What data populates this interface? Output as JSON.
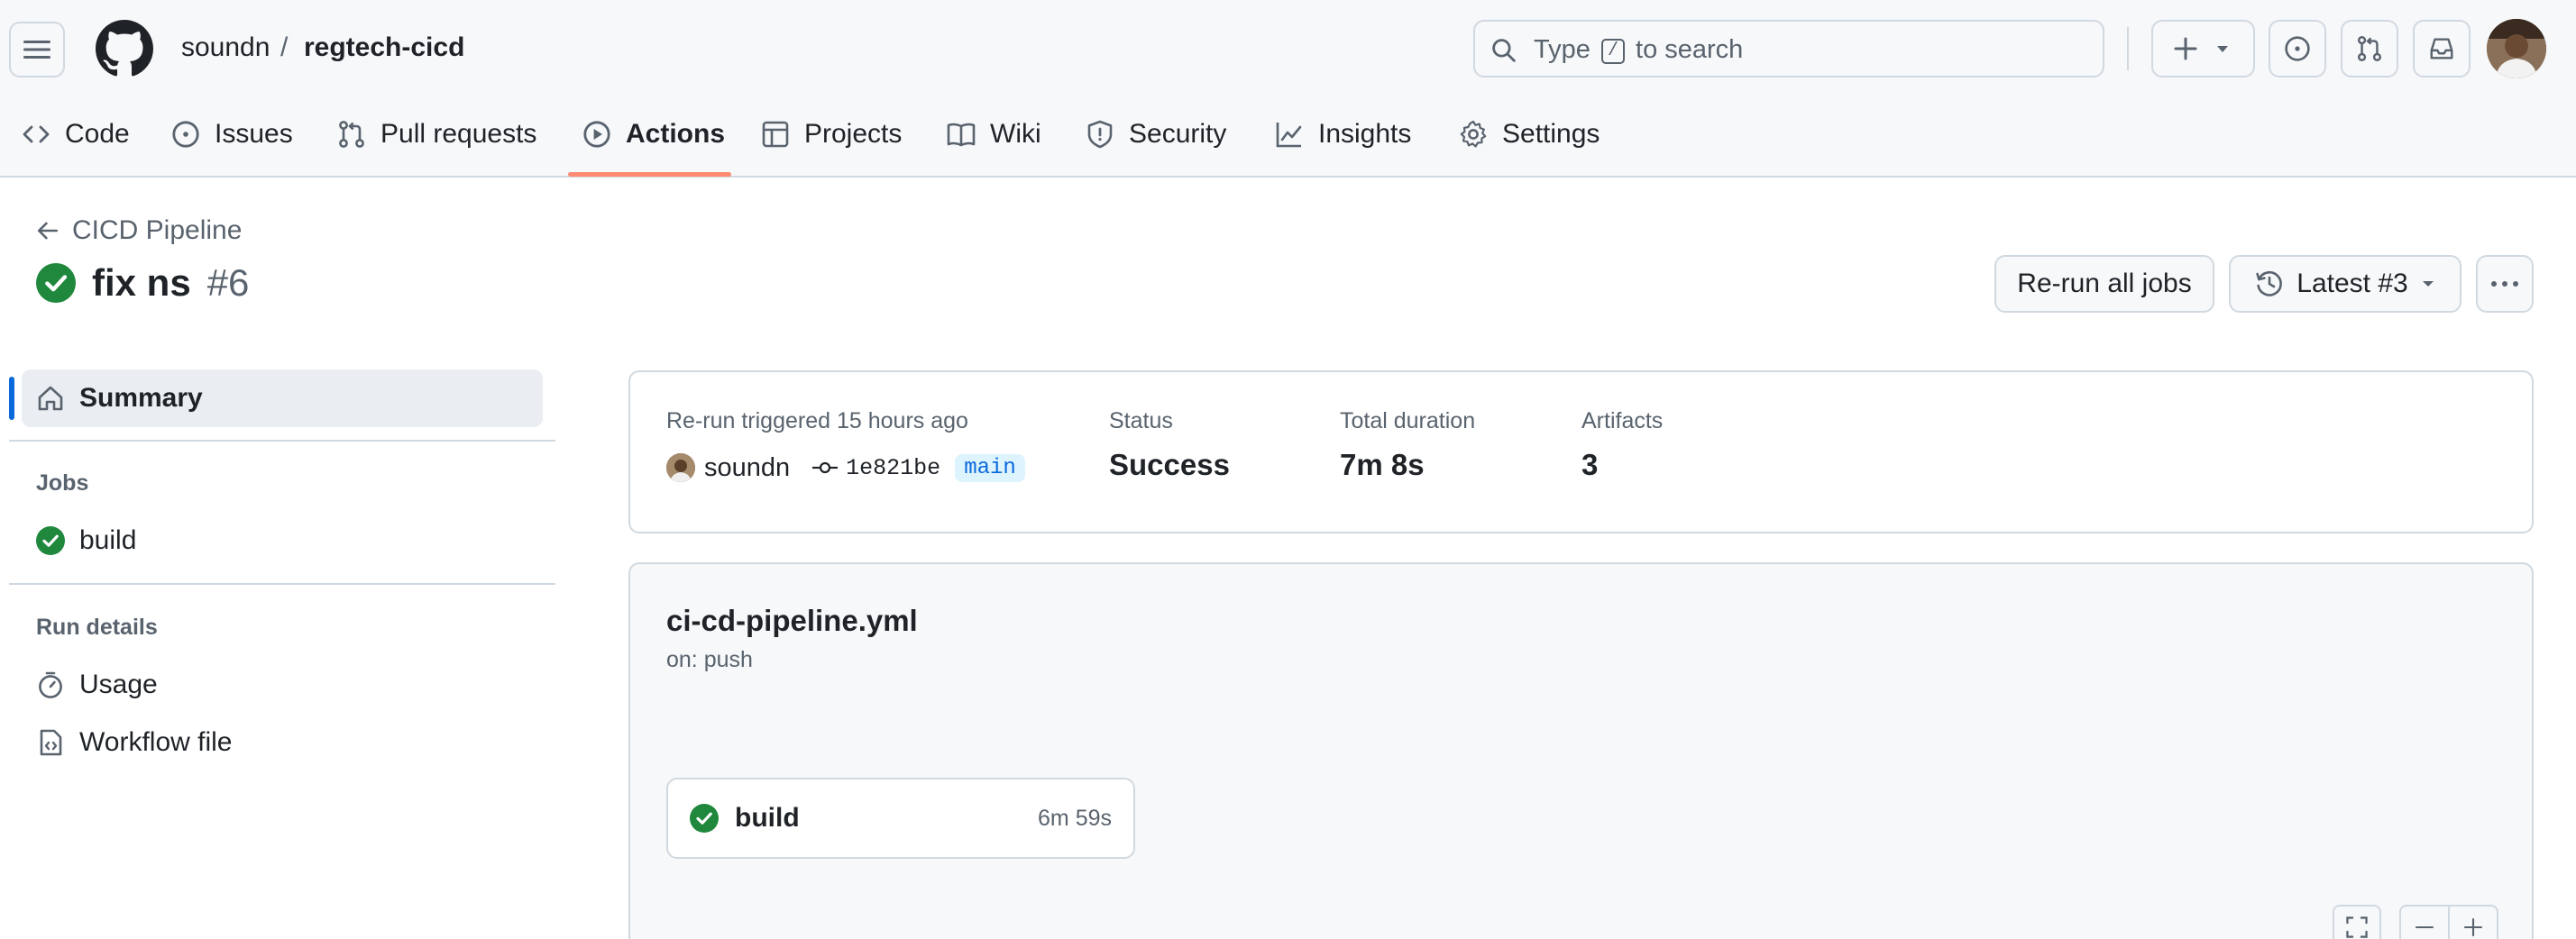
{
  "header": {
    "owner": "soundn",
    "separator": "/",
    "repo": "regtech-cicd",
    "search_prefix": "Type",
    "search_key": "/",
    "search_suffix": "to search"
  },
  "nav": [
    {
      "label": "Code",
      "icon": "code-icon"
    },
    {
      "label": "Issues",
      "icon": "issue-opened-icon"
    },
    {
      "label": "Pull requests",
      "icon": "git-pull-request-icon"
    },
    {
      "label": "Actions",
      "icon": "play-icon",
      "active": true
    },
    {
      "label": "Projects",
      "icon": "table-icon"
    },
    {
      "label": "Wiki",
      "icon": "book-icon"
    },
    {
      "label": "Security",
      "icon": "shield-icon"
    },
    {
      "label": "Insights",
      "icon": "graph-icon"
    },
    {
      "label": "Settings",
      "icon": "gear-icon"
    }
  ],
  "run": {
    "back_label": "CICD Pipeline",
    "title": "fix ns",
    "number": "#6",
    "rerun_label": "Re-run all jobs",
    "attempt_label": "Latest #3"
  },
  "sidebar": {
    "summary_label": "Summary",
    "jobs_heading": "Jobs",
    "jobs": [
      {
        "label": "build",
        "status": "success"
      }
    ],
    "details_heading": "Run details",
    "details": [
      {
        "label": "Usage",
        "icon": "stopwatch-icon"
      },
      {
        "label": "Workflow file",
        "icon": "file-code-icon"
      }
    ]
  },
  "summary": {
    "trigger_label": "Re-run triggered 15 hours ago",
    "actor": "soundn",
    "commit": "1e821be",
    "branch": "main",
    "status_label": "Status",
    "status_value": "Success",
    "duration_label": "Total duration",
    "duration_value": "7m 8s",
    "artifacts_label": "Artifacts",
    "artifacts_value": "3"
  },
  "workflow": {
    "file": "ci-cd-pipeline.yml",
    "trigger": "on: push",
    "jobs": [
      {
        "name": "build",
        "duration": "6m 59s",
        "status": "success"
      }
    ]
  },
  "colors": {
    "success": "#1f883d",
    "accent": "#0969da",
    "active_underline": "#fd8c73"
  }
}
